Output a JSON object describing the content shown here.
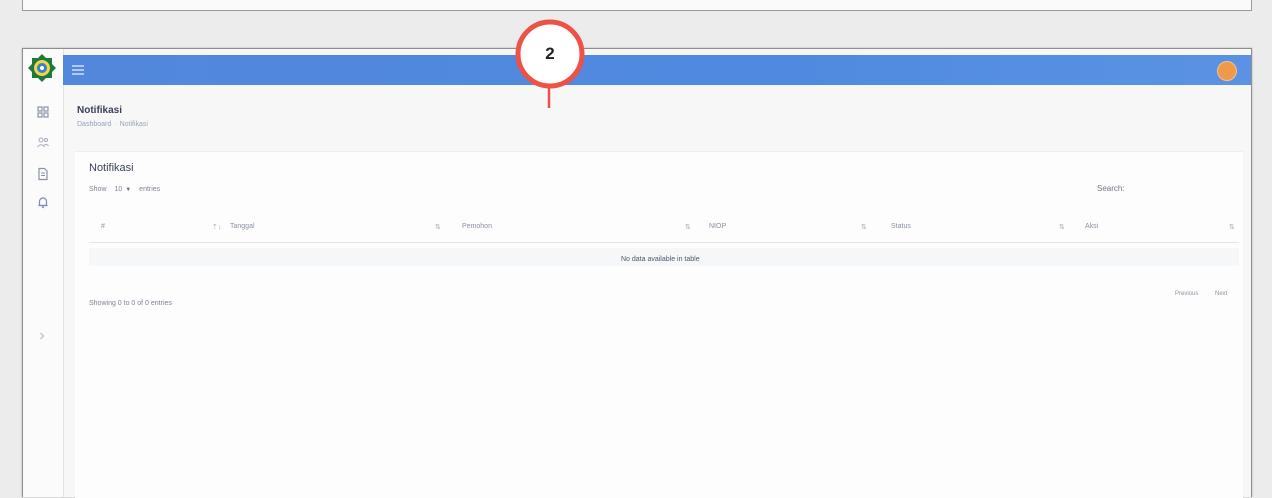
{
  "annotation": {
    "number": "2"
  },
  "sidebar": {
    "items": [
      {
        "icon": "dashboard-grid-icon"
      },
      {
        "icon": "users-icon"
      },
      {
        "icon": "document-icon"
      },
      {
        "icon": "bell-icon"
      }
    ],
    "collapse_icon": "chevron-right-icon"
  },
  "topbar": {
    "menu_icon": "hamburger-icon",
    "avatar_color": "#f1994a",
    "bar_color": "#5287dc"
  },
  "page": {
    "title": "Notifikasi",
    "breadcrumb": [
      {
        "label": "Dashboard",
        "current": false
      },
      {
        "label": "Notifikasi",
        "current": true
      }
    ]
  },
  "card": {
    "title": "Notifikasi",
    "length": {
      "show_label": "Show",
      "value": "10",
      "entries_label": "entries"
    },
    "search_label": "Search:",
    "search_value": ""
  },
  "table": {
    "columns": [
      "#",
      "Tanggal",
      "Pemohon",
      "NIOP",
      "Status",
      "Aksi"
    ],
    "empty_message": "No data available in table",
    "info": "Showing 0 to 0 of 0 entries",
    "previous_label": "Previous",
    "next_label": "Next"
  }
}
